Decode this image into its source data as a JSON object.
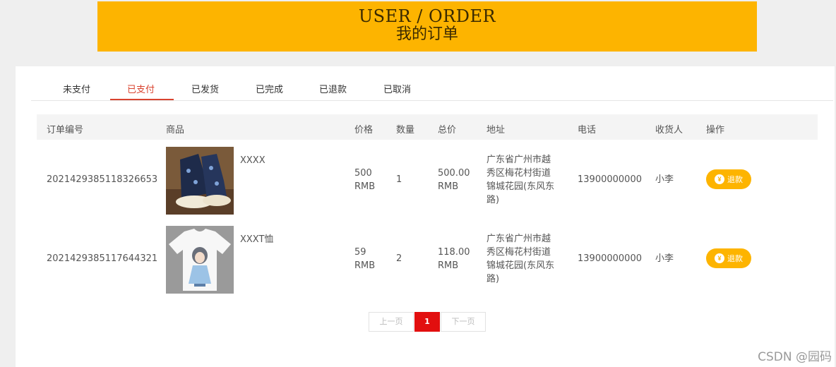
{
  "banner": {
    "title_en": "USER / ORDER",
    "title_zh": "我的订单"
  },
  "tabs": [
    {
      "label": "未支付",
      "active": false
    },
    {
      "label": "已支付",
      "active": true
    },
    {
      "label": "已发货",
      "active": false
    },
    {
      "label": "已完成",
      "active": false
    },
    {
      "label": "已退款",
      "active": false
    },
    {
      "label": "已取消",
      "active": false
    }
  ],
  "table": {
    "headers": {
      "order_no": "订单编号",
      "product": "商品",
      "price": "价格",
      "qty": "数量",
      "total": "总价",
      "address": "地址",
      "phone": "电话",
      "receiver": "收货人",
      "action": "操作"
    },
    "rows": [
      {
        "order_no": "2021429385118326653",
        "product_name": "XXXX",
        "product_icon": "sneaker-image",
        "price_value": "500",
        "price_unit": "RMB",
        "qty": "1",
        "total_value": "500.00",
        "total_unit": "RMB",
        "address_lines": [
          "广东省广州市越",
          "秀区梅花村街道",
          "锦城花园(东风东",
          "路)"
        ],
        "phone": "13900000000",
        "receiver": "小李",
        "action_label": "退款"
      },
      {
        "order_no": "2021429385117644321",
        "product_name": "XXXT恤",
        "product_icon": "tshirt-image",
        "price_value": "59",
        "price_unit": "RMB",
        "qty": "2",
        "total_value": "118.00",
        "total_unit": "RMB",
        "address_lines": [
          "广东省广州市越",
          "秀区梅花村街道",
          "锦城花园(东风东",
          "路)"
        ],
        "phone": "13900000000",
        "receiver": "小李",
        "action_label": "退款"
      }
    ]
  },
  "pager": {
    "prev": "上一页",
    "current": "1",
    "next": "下一页"
  },
  "watermark": "CSDN @园码",
  "colors": {
    "accent": "#fdb400",
    "active_tab": "#d9432f",
    "pager_current": "#e20f0f"
  }
}
